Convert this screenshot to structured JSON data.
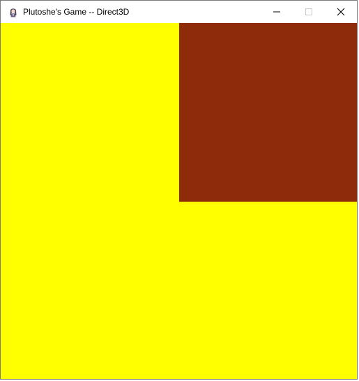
{
  "window": {
    "title": "Plutoshe's Game -- Direct3D",
    "app_icon": "character-avatar-icon",
    "controls": [
      "minimize-icon",
      "maximize-icon",
      "close-icon"
    ]
  },
  "scene": {
    "background_color": "#FFFF00",
    "rect_color": "#8E2B0A",
    "border_color": "#7A7A7A"
  }
}
